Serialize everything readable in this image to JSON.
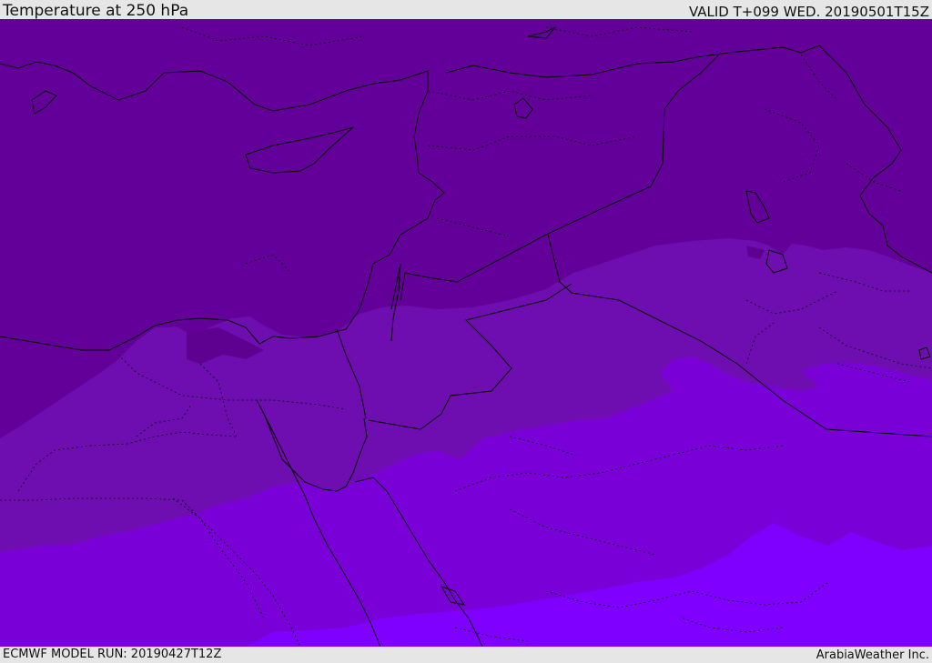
{
  "header": {
    "title": "Temperature at 250 hPa",
    "valid": "VALID T+099 WED. 20190501T15Z"
  },
  "footer": {
    "model_run": "ECMWF MODEL RUN: 20190427T12Z",
    "credit": "ArabiaWeather Inc."
  },
  "colors": {
    "band_coldest": "#64009a",
    "band_cold": "#6e0eb0",
    "band_mid": "#7a00d8",
    "band_warm": "#7f00ff",
    "coastline": "#000000",
    "background_bars": "#e6e6e6"
  }
}
